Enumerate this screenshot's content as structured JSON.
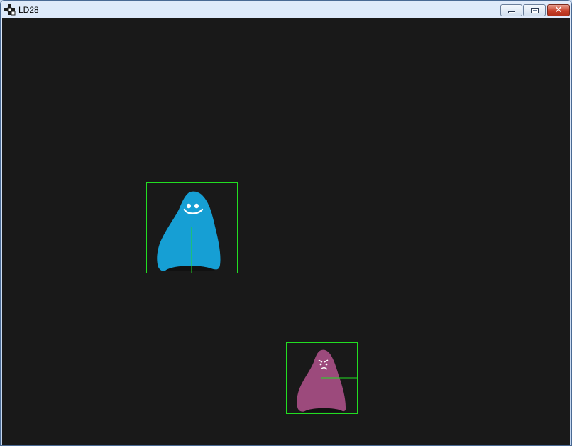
{
  "window": {
    "title": "LD28",
    "close_glyph": "✕"
  },
  "colors": {
    "canvas_background": "#191919",
    "hitbox_outline": "#22dd22",
    "player_body": "#169fd4",
    "enemy_body": "#9c4a7c",
    "face": "#ffffff",
    "shadow": "#111111"
  },
  "icons": {
    "app": "app-logo-icon",
    "minimize": "minimize-icon",
    "maximize": "maximize-icon",
    "close": "close-icon"
  },
  "entities": [
    {
      "name": "player-ghost",
      "mood": "happy",
      "body_color": "#169fd4"
    },
    {
      "name": "enemy-ghost",
      "mood": "angry",
      "body_color": "#9c4a7c"
    }
  ]
}
